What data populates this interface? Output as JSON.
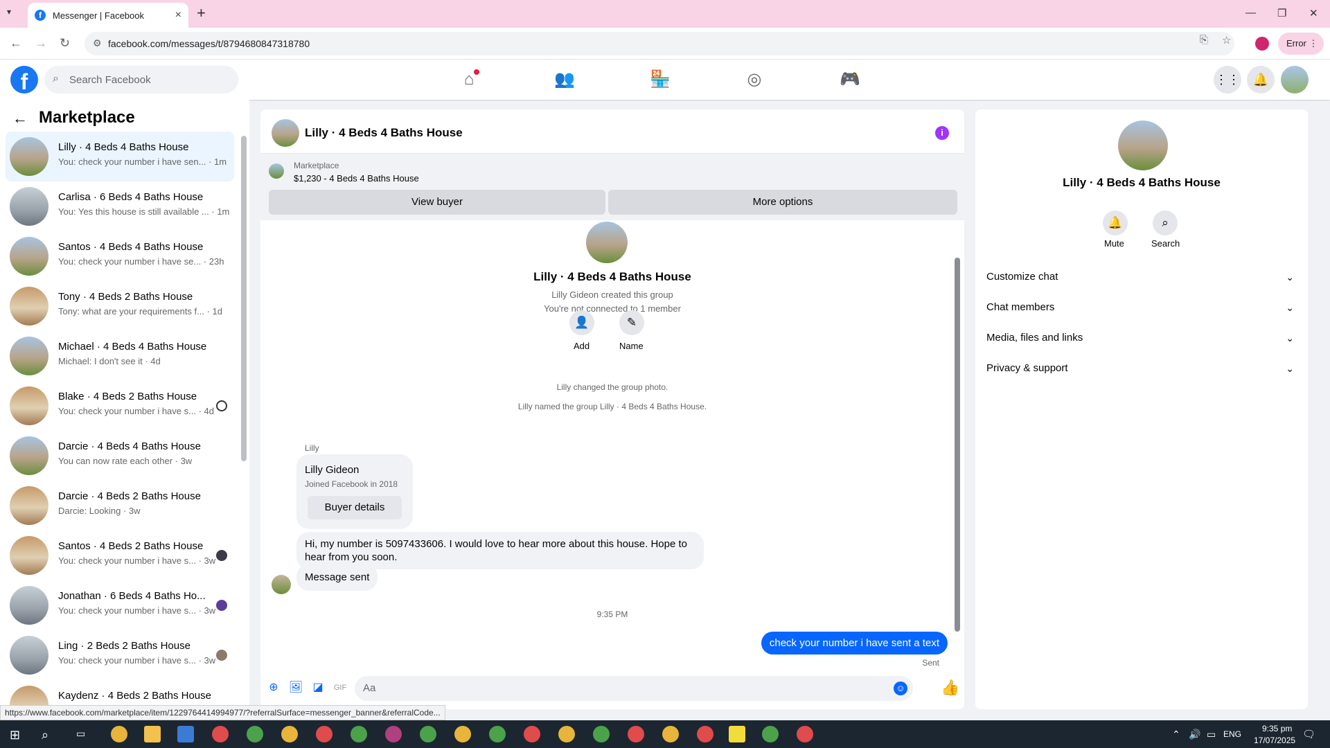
{
  "browser": {
    "tab_title": "Messenger | Facebook",
    "url": "facebook.com/messages/t/8794680847318780",
    "error_label": "Error",
    "status_url": "https://www.facebook.com/marketplace/item/1229764414994977/?referralSurface=messenger_banner&referralCode..."
  },
  "fb": {
    "search_placeholder": "Search Facebook"
  },
  "sidebar": {
    "title": "Marketplace",
    "conversations": [
      {
        "name": "Lilly · 4 Beds 4 Baths House",
        "preview": "You: check your number i have sen... · 1m"
      },
      {
        "name": "Carlisa · 6 Beds 4 Baths House",
        "preview": "You: Yes this house is still available ... · 1m"
      },
      {
        "name": "Santos · 4 Beds 4 Baths House",
        "preview": "You: check your number i have se... · 23h"
      },
      {
        "name": "Tony · 4 Beds 2 Baths House",
        "preview": "Tony: what are your requirements f... · 1d"
      },
      {
        "name": "Michael · 4 Beds 4 Baths House",
        "preview": "Michael: I don't see it · 4d"
      },
      {
        "name": "Blake · 4 Beds 2 Baths House",
        "preview": "You: check your number i have s... · 4d"
      },
      {
        "name": "Darcie · 4 Beds 4 Baths House",
        "preview": "You can now rate each other · 3w"
      },
      {
        "name": "Darcie · 4 Beds 2 Baths House",
        "preview": "Darcie: Looking · 3w"
      },
      {
        "name": "Santos · 4 Beds 2 Baths House",
        "preview": "You: check your number i have s... · 3w"
      },
      {
        "name": "Jonathan · 6 Beds 4 Baths Ho...",
        "preview": "You: check your number i have s... · 3w"
      },
      {
        "name": "Ling · 2 Beds 2 Baths House",
        "preview": "You: check your number i have s... · 3w"
      },
      {
        "name": "Kaydenz · 4 Beds 2 Baths House",
        "preview": ""
      }
    ]
  },
  "chat": {
    "title": "Lilly · 4 Beds 4 Baths House",
    "marketplace_label": "Marketplace",
    "listing": "$1,230 - 4 Beds 4 Baths House",
    "view_buyer": "View buyer",
    "more_options": "More options",
    "group_title": "Lilly · 4 Beds 4 Baths House",
    "created_by": "Lilly Gideon created this group",
    "not_connected": "You're not connected to 1 member",
    "add_label": "Add",
    "name_label": "Name",
    "sys1": "Lilly changed the group photo.",
    "sys2": "Lilly named the group Lilly · 4 Beds 4 Baths House.",
    "sender": "Lilly",
    "card_name": "Lilly Gideon",
    "card_joined": "Joined Facebook in 2018",
    "card_button": "Buyer details",
    "msg1": "Hi, my number is 5097433606. I would love to hear more about this house. Hope to hear from you soon.",
    "msg2": "Message sent",
    "time": "9:35 PM",
    "outgoing": "check your number i have sent a text",
    "sent_status": "Sent",
    "composer_placeholder": "Aa"
  },
  "rpanel": {
    "title": "Lilly · 4 Beds 4 Baths House",
    "mute": "Mute",
    "search": "Search",
    "rows": [
      "Customize chat",
      "Chat members",
      "Media, files and links",
      "Privacy & support"
    ]
  },
  "taskbar": {
    "lang": "ENG",
    "time": "9:35 pm",
    "date": "17/07/2025"
  }
}
